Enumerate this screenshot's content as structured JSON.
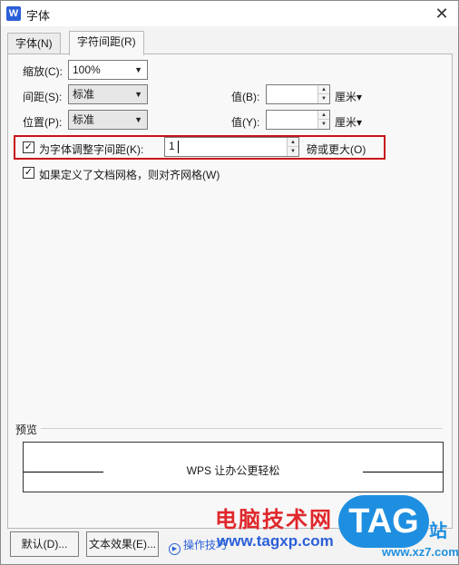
{
  "window": {
    "title": "字体",
    "app_icon": "W",
    "close_glyph": "✕"
  },
  "tabs": [
    {
      "label": "字体(N)",
      "active": false
    },
    {
      "label": "字符间距(R)",
      "active": true
    }
  ],
  "scale": {
    "label": "缩放(C):",
    "value": "100%"
  },
  "spacing": {
    "label": "间距(S):",
    "value": "标准",
    "value_label": "值(B):",
    "amount": "",
    "unit": "厘米▾"
  },
  "position": {
    "label": "位置(P):",
    "value": "标准",
    "value_label": "值(Y):",
    "amount": "",
    "unit": "厘米▾"
  },
  "kerning": {
    "checked": true,
    "label": "为字体调整字间距(K):",
    "value": "1",
    "suffix": "磅或更大(O)"
  },
  "grid_snap": {
    "checked": true,
    "label": "如果定义了文档网格，则对齐网格(W)"
  },
  "preview": {
    "label": "预览",
    "sample_text": "WPS 让办公更轻松"
  },
  "buttons": {
    "default": "默认(D)...",
    "text_effects": "文本效果(E)...",
    "tips": "操作技巧"
  },
  "watermark": {
    "site_name": "电脑技术网",
    "url": "www.tagxp.com",
    "badge": "TAG",
    "zhan": "站",
    "xz": "www.xz7.com"
  },
  "colors": {
    "highlight": "#c8121a",
    "brand_blue": "#2b5fd9"
  }
}
